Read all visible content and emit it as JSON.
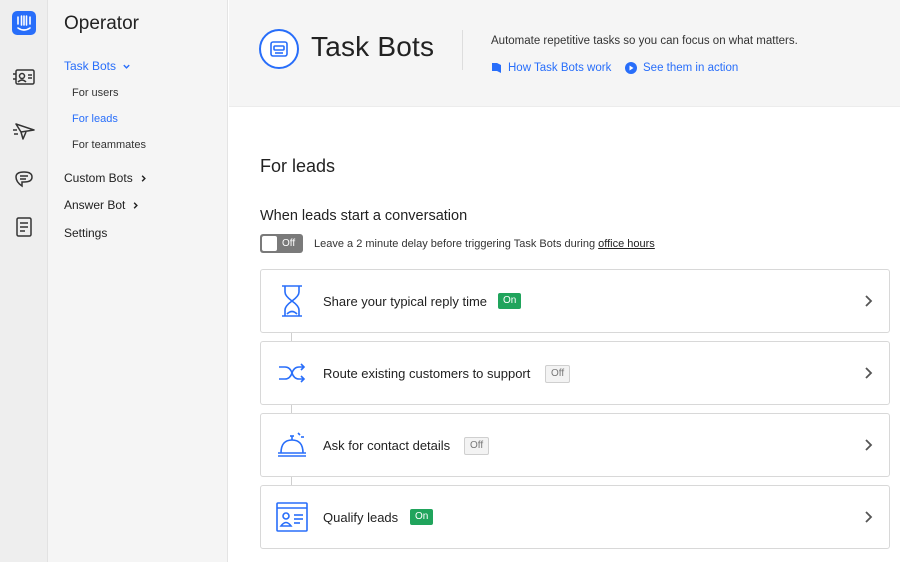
{
  "sidebar": {
    "title": "Operator",
    "items": [
      {
        "label": "Task Bots",
        "active": true
      },
      {
        "label": "Custom Bots"
      },
      {
        "label": "Answer Bot"
      },
      {
        "label": "Settings"
      }
    ],
    "subitems": [
      {
        "label": "For users"
      },
      {
        "label": "For leads",
        "active": true
      },
      {
        "label": "For teammates"
      }
    ]
  },
  "rail": {
    "icons": [
      "intercom-logo-icon",
      "contacts-icon",
      "outbound-icon",
      "inbox-icon",
      "articles-icon"
    ]
  },
  "header": {
    "title": "Task Bots",
    "description": "Automate repetitive tasks so you can focus on what matters.",
    "link_how": "How Task Bots work",
    "link_see": "See them in action"
  },
  "main": {
    "section_title": "For leads",
    "subtitle": "When leads start a conversation",
    "toggle": {
      "label": "Off"
    },
    "delay_text": "Leave a 2 minute delay before triggering Task Bots during ",
    "delay_link": "office hours"
  },
  "cards": [
    {
      "label": "Share your typical reply time",
      "status": "On",
      "icon": "hourglass-icon"
    },
    {
      "label": "Route existing customers to support",
      "status": "Off",
      "icon": "shuffle-icon"
    },
    {
      "label": "Ask for contact details",
      "status": "Off",
      "icon": "reception-bell-icon"
    },
    {
      "label": "Qualify leads",
      "status": "On",
      "icon": "contact-card-icon"
    }
  ],
  "colors": {
    "accent": "#286efa",
    "on": "#20a45c",
    "logo": "#286efa"
  }
}
